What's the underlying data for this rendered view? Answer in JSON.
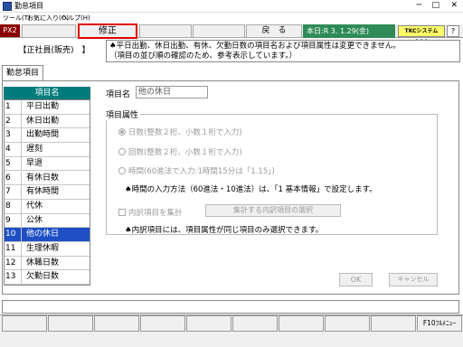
{
  "window": {
    "title": "勤怠項目",
    "minimize": "─",
    "maximize": "□",
    "close": "✕"
  },
  "menu": [
    "ツール(T)",
    "お気に入り(O)",
    "ヘルプ(H)"
  ],
  "toolbar": {
    "mode": "PX2",
    "edit_label": "修正",
    "back_label": "戻　る",
    "date_label": "本日:R 3. 1.29(金)",
    "brand_label": "TKCシステムQ&A",
    "brand_icon": "help-icon"
  },
  "employee_label": "【正社員(販売)　】",
  "notice": [
    "♠平日出勤、休日出勤、有休、欠勤日数の項目名および項目属性は変更できません。",
    "（項目の並び順の確認のため、参考表示しています。）"
  ],
  "tab_label": "勤怠項目",
  "list": {
    "header": "項目名",
    "items": [
      {
        "num": "1",
        "label": "平日出勤"
      },
      {
        "num": "2",
        "label": "休日出勤"
      },
      {
        "num": "3",
        "label": "出勤時間"
      },
      {
        "num": "4",
        "label": "遅刻"
      },
      {
        "num": "5",
        "label": "早退"
      },
      {
        "num": "6",
        "label": "有休日数"
      },
      {
        "num": "7",
        "label": "有休時間"
      },
      {
        "num": "8",
        "label": "代休"
      },
      {
        "num": "9",
        "label": "公休"
      },
      {
        "num": "10",
        "label": "他の休日"
      },
      {
        "num": "11",
        "label": "生理休暇"
      },
      {
        "num": "12",
        "label": "休職日数"
      },
      {
        "num": "13",
        "label": "欠勤日数"
      }
    ],
    "selected_index": 9
  },
  "detail": {
    "name_label": "項目名",
    "name_value": "他の休日",
    "group_title": "項目属性",
    "radio_days": "日数(整数２桁、小数１桁で入力)",
    "radio_times": "回数(整数２桁、小数１桁で入力)",
    "radio_hours": "時間(60進法で入力:1時間15分は「1.15」)",
    "note_time": "♠時間の入力方法（60進法・10進法）は、「1 基本情報」で設定します。",
    "check_breakdown": "内訳項目を集計",
    "select_breakdown_button": "集計する内訳項目の選択",
    "note_breakdown": "♠内訳項目には、項目属性が同じ項目のみ選択できます。",
    "ok_label": "OK",
    "cancel_label": "キャンセル"
  },
  "fkeys": [
    "",
    "",
    "",
    "",
    "",
    "",
    "",
    "",
    "",
    "F10ﾌﾙﾒﾆｭｰ"
  ]
}
